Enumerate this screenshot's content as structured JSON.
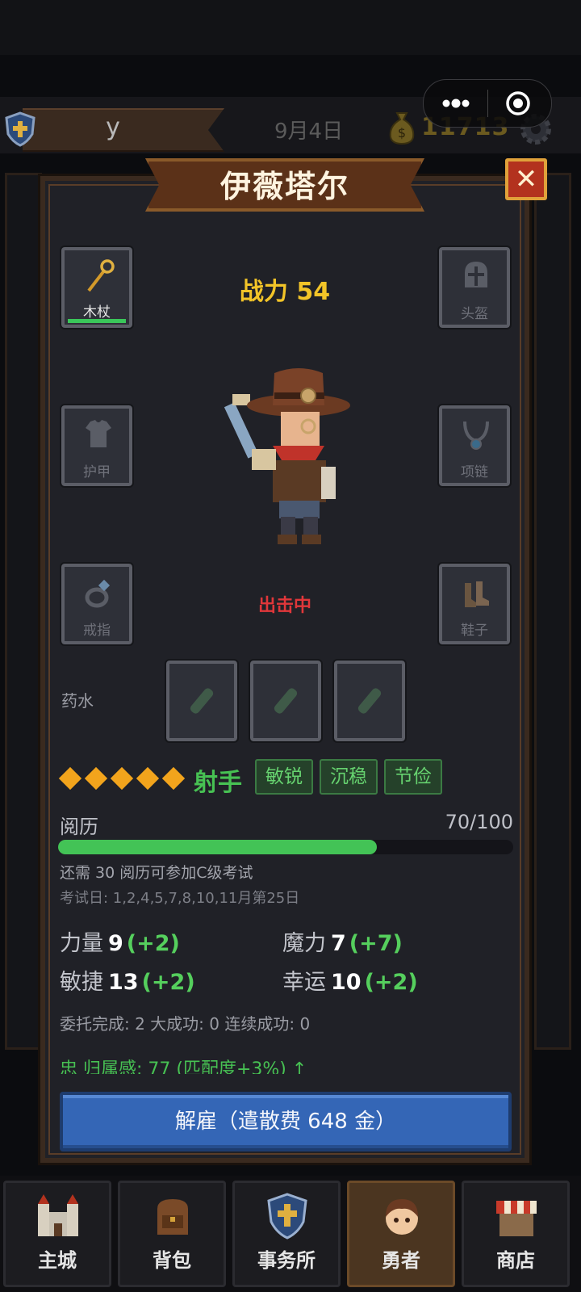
{
  "header": {
    "player_name": "y",
    "date": "9月4日",
    "coins": "11713"
  },
  "hero_panel": {
    "title": "伊薇塔尔",
    "close_label": "✕",
    "power": "战力 54",
    "status": "出击中",
    "slots": {
      "weapon": "木杖",
      "helmet": "头盔",
      "armor": "护甲",
      "necklace": "项链",
      "ring": "戒指",
      "shoes": "鞋子"
    },
    "potion_label": "药水",
    "rank_stars": 5,
    "class_name": "射手",
    "traits": [
      "敏锐",
      "沉稳",
      "节俭"
    ],
    "experience": {
      "label": "阅历",
      "value_text": "70/100",
      "progress": 0.7,
      "note": "还需 30 阅历可参加C级考试",
      "exam_days": "考试日: 1,2,4,5,7,8,10,11月第25日"
    },
    "stats": {
      "strength": {
        "label": "力量",
        "value": "9",
        "bonus": "(+2)"
      },
      "magic": {
        "label": "魔力",
        "value": "7",
        "bonus": "(+7)"
      },
      "agility": {
        "label": "敏捷",
        "value": "13",
        "bonus": "(+2)"
      },
      "luck": {
        "label": "幸运",
        "value": "10",
        "bonus": "(+2)"
      }
    },
    "counters": "委托完成: 2  大成功: 0  连续成功: 0",
    "loyalty": "忠  归属感: 77 (匹配度+3%) ↑",
    "fire_button": "解雇（遣散费 648 金）"
  },
  "navbar": {
    "tabs": [
      "主城",
      "背包",
      "事务所",
      "勇者",
      "商店"
    ],
    "active": "勇者"
  },
  "colors": {
    "accent_gold": "#f2c428",
    "status_red": "#e0373a",
    "green": "#47c153",
    "button_blue": "#3466b6"
  }
}
